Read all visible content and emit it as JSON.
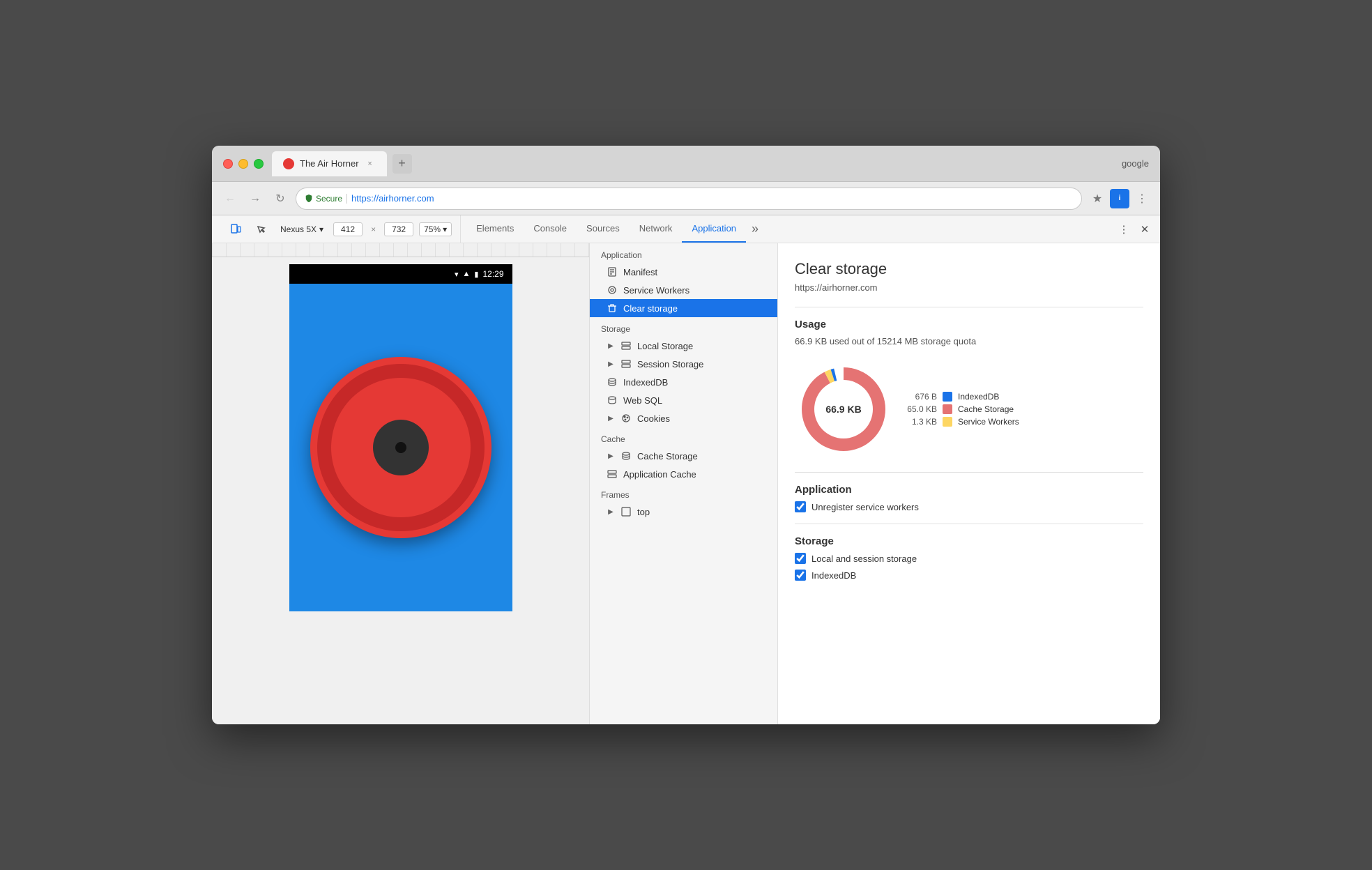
{
  "browser": {
    "title": "The Air Horner",
    "url_secure_label": "Secure",
    "url_full": "https://airhorner.com",
    "url_protocol": "https://",
    "url_domain": "airhorner.com",
    "user_label": "google",
    "tab_close": "×",
    "new_tab": "+"
  },
  "toolbar": {
    "device": "Nexus 5X",
    "width": "412",
    "height": "732",
    "zoom": "75%",
    "device_arrow": "▾",
    "zoom_arrow": "▾"
  },
  "devtools": {
    "tabs": [
      "Elements",
      "Console",
      "Sources",
      "Network",
      "Application"
    ],
    "active_tab": "Application"
  },
  "phone": {
    "time": "12:29"
  },
  "sidebar": {
    "application_header": "Application",
    "items_application": [
      {
        "label": "Manifest",
        "icon": "manifest"
      },
      {
        "label": "Service Workers",
        "icon": "gear"
      },
      {
        "label": "Clear storage",
        "icon": "trash",
        "active": true
      }
    ],
    "storage_header": "Storage",
    "items_storage": [
      {
        "label": "Local Storage",
        "icon": "grid",
        "expandable": true
      },
      {
        "label": "Session Storage",
        "icon": "grid",
        "expandable": true
      },
      {
        "label": "IndexedDB",
        "icon": "db"
      },
      {
        "label": "Web SQL",
        "icon": "db"
      },
      {
        "label": "Cookies",
        "icon": "cookie",
        "expandable": true
      }
    ],
    "cache_header": "Cache",
    "items_cache": [
      {
        "label": "Cache Storage",
        "icon": "db",
        "expandable": true
      },
      {
        "label": "Application Cache",
        "icon": "grid"
      }
    ],
    "frames_header": "Frames",
    "items_frames": [
      {
        "label": "top",
        "icon": "frame",
        "expandable": true
      }
    ]
  },
  "panel": {
    "title": "Clear storage",
    "url": "https://airhorner.com",
    "usage_title": "Usage",
    "usage_text": "66.9 KB used out of 15214 MB storage quota",
    "donut_label": "66.9 KB",
    "legend": [
      {
        "size": "676 B",
        "label": "IndexedDB",
        "color": "#1a73e8"
      },
      {
        "size": "65.0 KB",
        "label": "Cache Storage",
        "color": "#e57373"
      },
      {
        "size": "1.3 KB",
        "label": "Service Workers",
        "color": "#fdd663"
      }
    ],
    "application_title": "Application",
    "checkboxes_app": [
      {
        "label": "Unregister service workers",
        "checked": true
      }
    ],
    "storage_title": "Storage",
    "checkboxes_storage": [
      {
        "label": "Local and session storage",
        "checked": true
      },
      {
        "label": "IndexedDB",
        "checked": true
      }
    ]
  }
}
